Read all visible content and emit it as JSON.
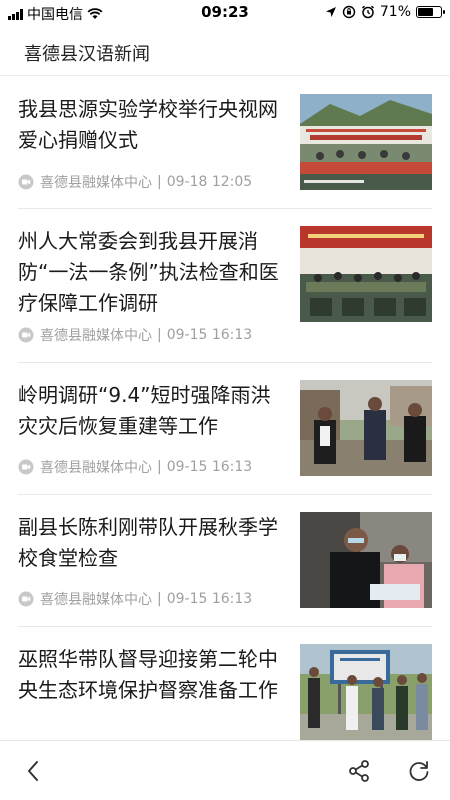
{
  "status_bar": {
    "carrier": "中国电信",
    "time": "09:23",
    "battery": "71%",
    "battery_level": 0.71
  },
  "header": {
    "title": "喜德县汉语新闻"
  },
  "news": [
    {
      "title": "我县思源实验学校举行央视网爱心捐赠仪式",
      "source": "喜德县融媒体中心",
      "time": "09-18 12:05",
      "thumbnail": "ceremony-banner-photo"
    },
    {
      "title": "州人大常委会到我县开展消防“一法一条例”执法检查和医疗保障工作调研",
      "source": "喜德县融媒体中心",
      "time": "09-15 16:13",
      "thumbnail": "meeting-room-photo"
    },
    {
      "title": "岭明调研“9.4”短时强降雨洪灾灾后恢复重建等工作",
      "source": "喜德县融媒体中心",
      "time": "09-15 16:13",
      "thumbnail": "officials-outdoor-photo"
    },
    {
      "title": "副县长陈利刚带队开展秋季学校食堂检查",
      "source": "喜德县融媒体中心",
      "time": "09-15 16:13",
      "thumbnail": "canteen-inspection-photo"
    },
    {
      "title": "巫照华带队督导迎接第二轮中央生态环境保护督察准备工作",
      "source": "",
      "time": "",
      "thumbnail": "billboard-inspection-photo"
    }
  ],
  "icons": {
    "back": "back-chevron-icon",
    "share": "share-icon",
    "refresh": "refresh-icon",
    "video": "video-icon"
  }
}
